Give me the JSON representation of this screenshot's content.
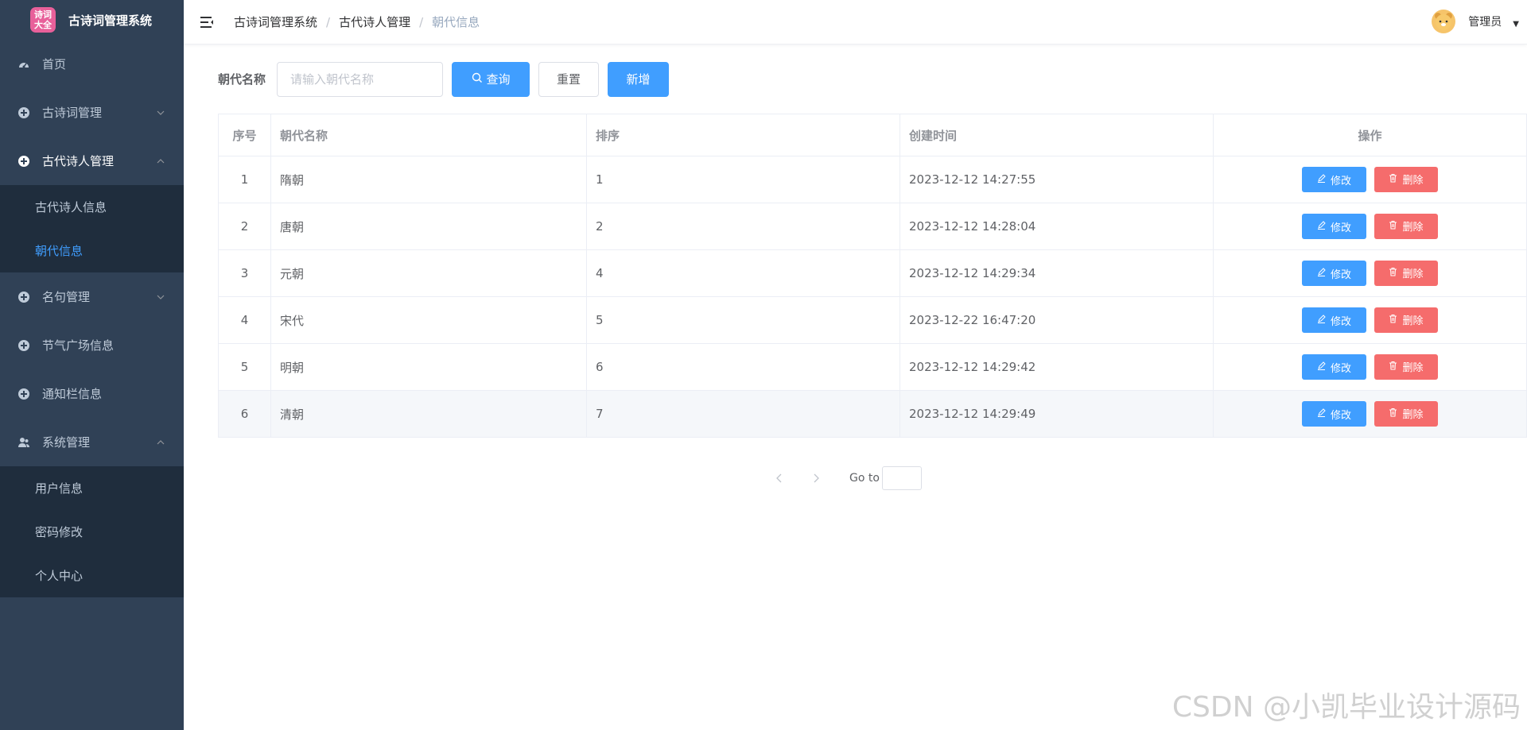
{
  "app": {
    "title": "古诗词管理系统",
    "logo_text_line1": "诗词",
    "logo_text_line2": "大全"
  },
  "sidebar": {
    "items": [
      {
        "label": "首页",
        "icon": "dashboard-icon"
      },
      {
        "label": "古诗词管理",
        "icon": "circle-plus-icon",
        "chevron": "down"
      },
      {
        "label": "古代诗人管理",
        "icon": "circle-plus-icon",
        "chevron": "up",
        "open": true,
        "children": [
          {
            "label": "古代诗人信息"
          },
          {
            "label": "朝代信息",
            "active": true
          }
        ]
      },
      {
        "label": "名句管理",
        "icon": "circle-plus-icon",
        "chevron": "down"
      },
      {
        "label": "节气广场信息",
        "icon": "circle-plus-icon"
      },
      {
        "label": "通知栏信息",
        "icon": "circle-plus-icon"
      },
      {
        "label": "系统管理",
        "icon": "user-group-icon",
        "chevron": "up",
        "open": true,
        "children": [
          {
            "label": "用户信息"
          },
          {
            "label": "密码修改"
          },
          {
            "label": "个人中心"
          }
        ]
      }
    ]
  },
  "header": {
    "breadcrumb": [
      "古诗词管理系统",
      "古代诗人管理",
      "朝代信息"
    ],
    "user_name": "管理员"
  },
  "search": {
    "label": "朝代名称",
    "placeholder": "请输入朝代名称",
    "value": "",
    "query_label": "查询",
    "reset_label": "重置",
    "add_label": "新增"
  },
  "table": {
    "columns": [
      "序号",
      "朝代名称",
      "排序",
      "创建时间",
      "操作"
    ],
    "rows": [
      {
        "no": "1",
        "name": "隋朝",
        "sort": "1",
        "time": "2023-12-12 14:27:55"
      },
      {
        "no": "2",
        "name": "唐朝",
        "sort": "2",
        "time": "2023-12-12 14:28:04"
      },
      {
        "no": "3",
        "name": "元朝",
        "sort": "4",
        "time": "2023-12-12 14:29:34"
      },
      {
        "no": "4",
        "name": "宋代",
        "sort": "5",
        "time": "2023-12-22 16:47:20"
      },
      {
        "no": "5",
        "name": "明朝",
        "sort": "6",
        "time": "2023-12-12 14:29:42"
      },
      {
        "no": "6",
        "name": "清朝",
        "sort": "7",
        "time": "2023-12-12 14:29:49"
      }
    ],
    "edit_label": "修改",
    "delete_label": "删除"
  },
  "pagination": {
    "goto_label": "Go to",
    "goto_value": ""
  },
  "watermark": "CSDN @小凯毕业设计源码",
  "colors": {
    "sidebar_bg": "#304156",
    "submenu_bg": "#1f2d3d",
    "primary": "#409eff",
    "danger": "#f56c6c",
    "active_text": "#409eff"
  }
}
